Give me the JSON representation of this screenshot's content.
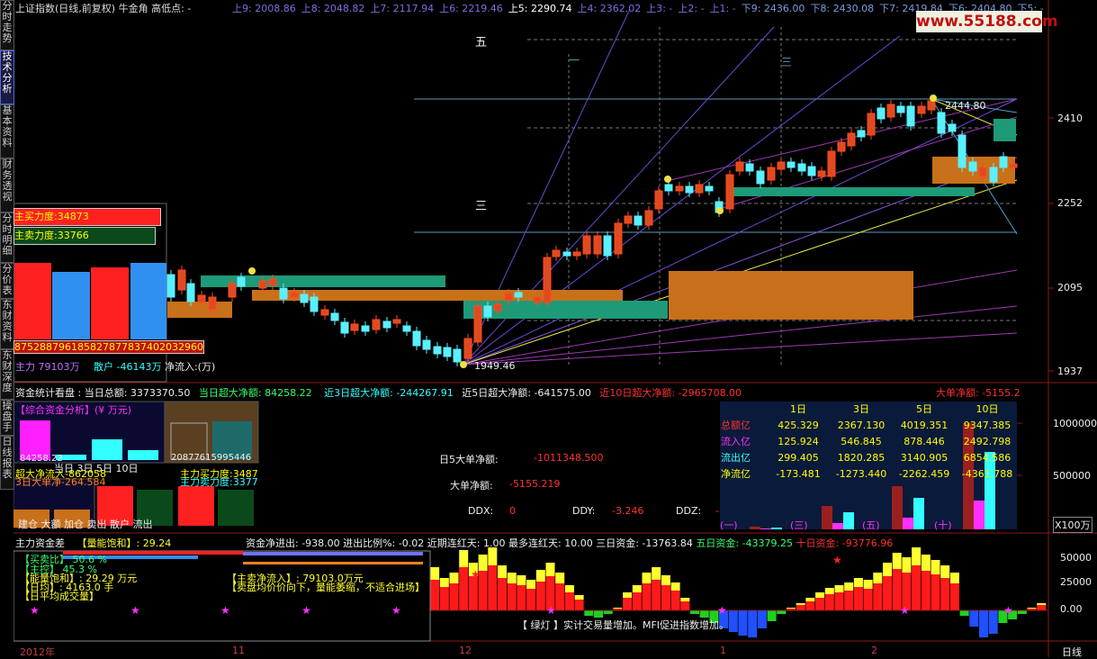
{
  "sidebar": {
    "tabs": [
      {
        "label": "分时走势",
        "active": false
      },
      {
        "label": "技术分析",
        "active": true
      },
      {
        "label": "基本资料",
        "active": false
      },
      {
        "label": "财务透视",
        "active": false
      },
      {
        "label": "分时明细",
        "active": false
      },
      {
        "label": "分价表",
        "active": false
      },
      {
        "label": "东财资料",
        "active": false
      },
      {
        "label": "东财深度",
        "active": false
      },
      {
        "label": "操盘手",
        "active": false
      },
      {
        "label": "日线报表",
        "active": false
      }
    ]
  },
  "header": {
    "title": "上证指数(日线,前复权) 牛金角  高低点: -",
    "levels": [
      "上9: 2008.86",
      "上8: 2048.82",
      "上7: 2117.94",
      "上6: 2219.46",
      "上5: 2290.74",
      "上4: 2362.02",
      "上3: -",
      "上2: -",
      "上1: -",
      "下9: 2436.00",
      "下8: 2430.08",
      "下7: 2419.84",
      "下6: 2404.80",
      "下5: -"
    ],
    "watermark": "www.55188.com"
  },
  "main_chart": {
    "labels": {
      "wu": "五",
      "san_left": "三",
      "yi": "一",
      "san_right": "三"
    },
    "price_high_label": "2444.80",
    "price_low_label": "1949.46",
    "y_axis": [
      "2410",
      "2252",
      "2095",
      "1937"
    ],
    "buy_strength": "主买力度:34873",
    "sell_strength": "主卖力度:33766",
    "bar_values": [
      "87528",
      "87961",
      "85",
      "82787",
      "78374",
      "020",
      "32960"
    ],
    "bottom_line": {
      "main": "主力 79103万",
      "retail": "散户 -46143万",
      "inflow": "净流入:(万)"
    }
  },
  "fund_row": {
    "title": "资金统计看盘 :",
    "today_total": "当日总额: 3373370.50",
    "today_super": "当日超大净额: 84258.22",
    "d3": "近3日超大净额: -244267.91",
    "d5": "近5日超大净额: -641575.00",
    "d10": "近10日超大净额: -2965708.00",
    "big_net": "大单净额: -5155.2"
  },
  "fund_panel": {
    "title": "【综合资金分析】(¥ 万元)",
    "row1": "84258.22",
    "row2": "超大净流入-862058",
    "row3": "3日大单净-264.584",
    "tabs": "当日 3日 5日 10日",
    "right1": "20877615995446",
    "right2": "主力买力度:3487",
    "right3": "主力卖力度:3377",
    "bottom": "建仓 大额 加仓 卖出 散户 流出"
  },
  "middle_text": {
    "d5_big_label": "日5大单净额:",
    "d5_big_value": "-1011348.500",
    "big_label": "大单净额:",
    "big_value": "-5155.219",
    "ddx_label": "DDX:",
    "ddx_value": "0",
    "ddy_label": "DDY:",
    "ddy_value": "-3.246",
    "ddz_label": "DDZ:",
    "ddz_value": "-"
  },
  "flow_table": {
    "columns": [
      "1日",
      "3日",
      "5日",
      "10日"
    ],
    "rows": [
      {
        "label": "总额亿",
        "values": [
          "425.329",
          "2367.130",
          "4019.351",
          "9347.385"
        ]
      },
      {
        "label": "流入亿",
        "values": [
          "125.924",
          "546.845",
          "878.446",
          "2492.798"
        ]
      },
      {
        "label": "流出亿",
        "values": [
          "299.405",
          "1820.285",
          "3140.905",
          "6854.586"
        ]
      },
      {
        "label": "净流亿",
        "values": [
          "-173.481",
          "-1273.440",
          "-2262.459",
          "-4361.788"
        ]
      }
    ],
    "x_labels": [
      "(一)",
      "(三)",
      "(五)",
      "(十)"
    ],
    "y_axis": [
      "1000000",
      "500000",
      "0.00"
    ],
    "unit": "X100万"
  },
  "bottom_row": {
    "title": "主力资金差",
    "energy": "【量能饱和】: 29.24",
    "net_in": "资金净进出: -938.00",
    "ratio": "进出比例%: -0.02",
    "red_days": "近期连红天: 1.00",
    "max_red": "最多连红天: 10.00",
    "d3": "三日资金: -13763.84",
    "d5": "五日资金: -43379.25",
    "d10": "十日资金: -93776.96"
  },
  "bottom_panel": {
    "buy_ratio": "【买卖比】  50.6 %",
    "main_ctrl": "【主控】      45.3 %",
    "energy_line": "【能量饱和】: 29.29 万元",
    "lines": [
      "【日均】: 4163.0 手",
      "【日平均成交量】",
      "【主卖净流入】: 79103.0万元",
      "【卖盘均价价向下，量能萎缩，不适合进场】"
    ],
    "light": "【 绿灯 】实计交易量增加。MFI促进指数增加。"
  },
  "bottom_axis": {
    "y": [
      "50000",
      "25000",
      "0.00"
    ],
    "x": [
      "2012年",
      "11",
      "12",
      "1",
      "2"
    ],
    "period": "日线"
  }
}
